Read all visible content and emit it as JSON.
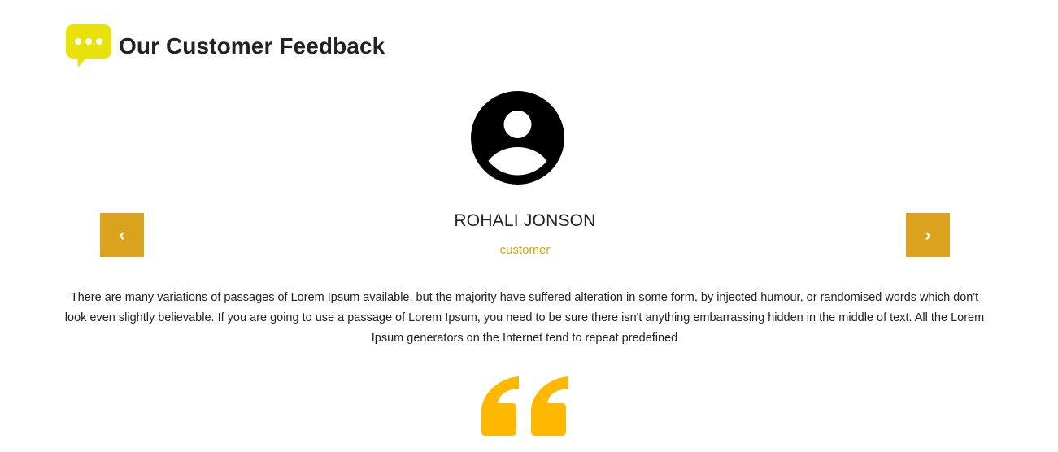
{
  "section": {
    "title": "Our Customer Feedback",
    "icon": "speech-bubble-icon",
    "accent_color": "#e8e20a"
  },
  "testimonial": {
    "avatar_icon": "user-avatar-icon",
    "name": "ROHALI JONSON",
    "role": "customer",
    "text": "There are many variations of passages of Lorem Ipsum available, but the majority have suffered alteration in some form, by injected humour, or randomised words which don't look even slightly believable. If you are going to use a passage of Lorem Ipsum, you need to be sure there isn't anything embarrassing hidden in the middle of text. All the Lorem Ipsum generators on the Internet tend to repeat predefined",
    "quote_icon": "quote-mark-icon",
    "quote_color": "#ffb800"
  },
  "carousel": {
    "prev_label": "‹",
    "next_label": "›",
    "button_color": "#dba21e"
  }
}
